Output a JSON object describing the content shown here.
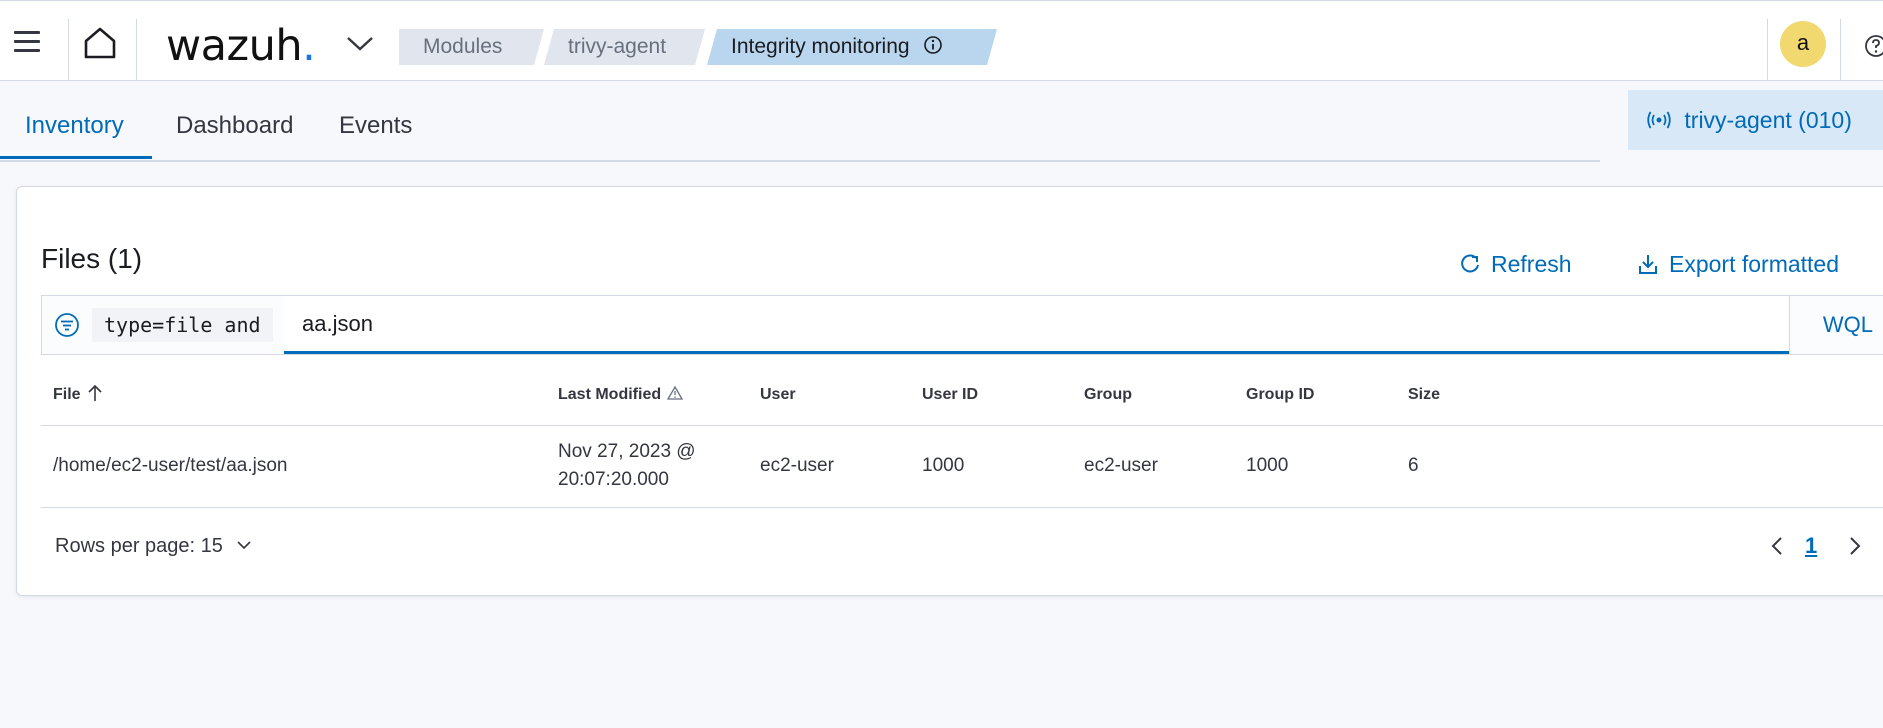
{
  "header": {
    "logo_text": "wazuh",
    "logo_dot": ".",
    "breadcrumbs": [
      {
        "label": "Modules"
      },
      {
        "label": "trivy-agent"
      },
      {
        "label": "Integrity monitoring"
      }
    ],
    "avatar_letter": "a"
  },
  "tabs": [
    {
      "label": "Inventory",
      "active": true
    },
    {
      "label": "Dashboard",
      "active": false
    },
    {
      "label": "Events",
      "active": false
    }
  ],
  "agent_badge": "trivy-agent (010)",
  "files_panel": {
    "title": "Files (1)",
    "refresh_label": "Refresh",
    "export_label": "Export formatted",
    "query_prefix": "type=file and",
    "query_value": "aa.json",
    "wql_label": "WQL",
    "columns": [
      "File",
      "Last Modified",
      "User",
      "User ID",
      "Group",
      "Group ID",
      "Size"
    ],
    "rows": [
      {
        "file": "/home/ec2-user/test/aa.json",
        "last_modified_1": "Nov 27, 2023 @",
        "last_modified_2": "20:07:20.000",
        "user": "ec2-user",
        "user_id": "1000",
        "group": "ec2-user",
        "group_id": "1000",
        "size": "6"
      }
    ],
    "rows_per_page": "Rows per page: 15",
    "current_page": "1"
  },
  "colors": {
    "accent": "#006bb8",
    "active_crumb": "#b9d6ee",
    "avatar": "#f1d86f"
  }
}
